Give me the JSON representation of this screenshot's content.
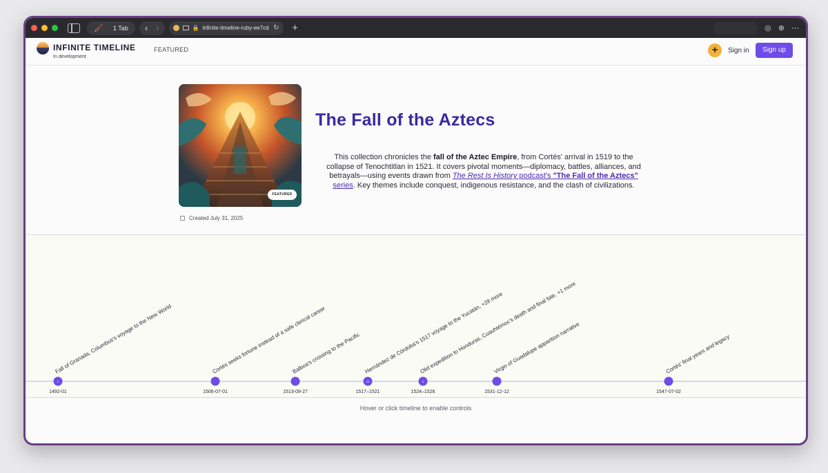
{
  "browser": {
    "tab_count": "1 Tab",
    "url": "infinite-timeline-ruby-ee7cd"
  },
  "header": {
    "brand": "INFINITE TIMELINE",
    "subtitle": "In development",
    "nav_featured": "FEATURED",
    "plus": "+",
    "sign_in": "Sign in",
    "sign_up": "Sign up"
  },
  "hero": {
    "featured_badge": "FEATURED",
    "created": "Created July 31, 2025",
    "title": "The Fall of the Aztecs",
    "desc": {
      "p1": "This collection chronicles the ",
      "b1": "fall of the Aztec Empire",
      "p2": ", from Cortés' arrival in 1519 to the collapse of Tenochtitlan in 1521. It covers pivotal moments—diplomacy, battles, alliances, and betrayals—using events drawn from ",
      "link1": "The Rest Is History",
      "link2": " podcast's ",
      "link3": "\"The Fall of the Aztecs\"",
      "link4": " series",
      "p3": ". Key themes include conquest, indigenous resistance, and the clash of civilizations."
    }
  },
  "timeline": {
    "hint": "Hover or click timeline to enable controls",
    "events": [
      {
        "date": "1492-01",
        "label": "Fall of Granada, Columbus's voyage to the New World",
        "count": "2"
      },
      {
        "date": "1506-07-01",
        "label": "Cortés seeks fortune instead of a safe clerical career",
        "count": ""
      },
      {
        "date": "1513-09-27",
        "label": "Balboa's crossing to the Pacific",
        "count": ""
      },
      {
        "date": "1517–1521",
        "label": "Hernández de Córdoba's 1517 voyage to the Yucatán, +28 more",
        "count": "29"
      },
      {
        "date": "1524–1526",
        "label": "Olid expedition to Honduras, Cuauhtémoc's death and final fate, +1 more",
        "count": "3"
      },
      {
        "date": "1531-12-12",
        "label": "Virgin of Guadalupe apparition narrative",
        "count": ""
      },
      {
        "date": "1547-07-02",
        "label": "Cortés' final years and legacy",
        "count": ""
      }
    ]
  },
  "colors": {
    "accent": "#6d4ce8",
    "title": "#3a2aa0",
    "button_plus": "#f2b13b",
    "timeline_line": "#a9b6ee"
  },
  "icons": {
    "calendar": "calendar-icon",
    "plus": "plus-icon"
  }
}
